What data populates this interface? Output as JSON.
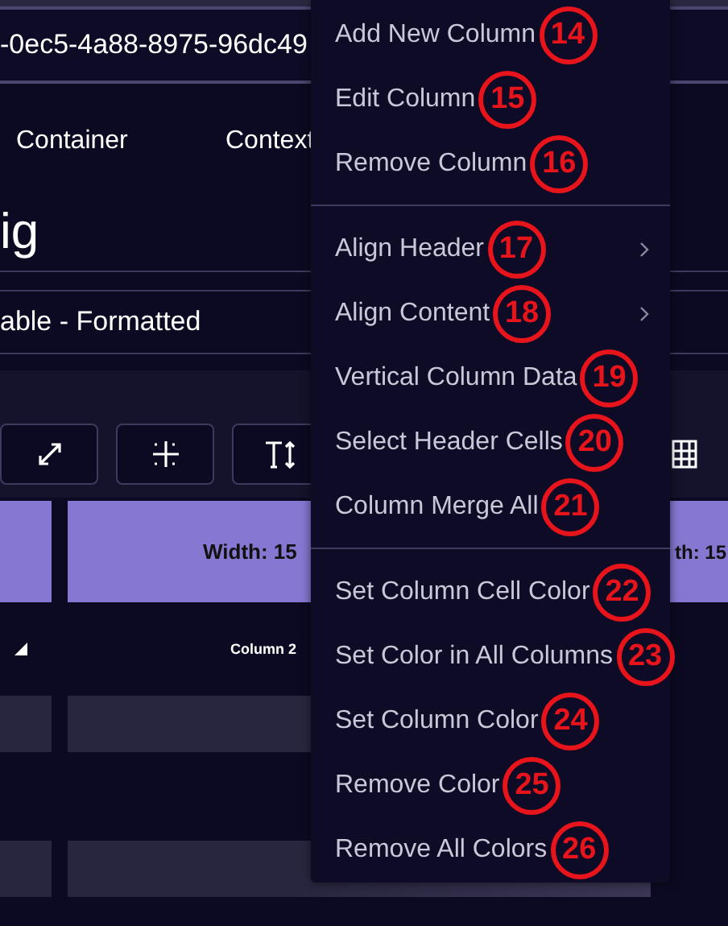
{
  "id_field": {
    "value": "-0ec5-4a88-8975-96dc49"
  },
  "tabs": [
    {
      "label": "Container"
    },
    {
      "label": "Context"
    }
  ],
  "title": "ig",
  "subtitle": "able - Formatted",
  "table": {
    "width_labels": [
      "Width: 15",
      "th: 15"
    ],
    "header": "Column 2"
  },
  "context_menu": {
    "sections": [
      {
        "items": [
          {
            "label": "Add New Column",
            "submenu": false,
            "badge": "14"
          },
          {
            "label": "Edit Column",
            "submenu": false,
            "badge": "15"
          },
          {
            "label": "Remove Column",
            "submenu": false,
            "badge": "16"
          }
        ]
      },
      {
        "items": [
          {
            "label": "Align Header",
            "submenu": true,
            "badge": "17"
          },
          {
            "label": "Align Content",
            "submenu": true,
            "badge": "18"
          },
          {
            "label": "Vertical Column Data",
            "submenu": false,
            "badge": "19"
          },
          {
            "label": "Select Header Cells",
            "submenu": false,
            "badge": "20"
          },
          {
            "label": "Column Merge All",
            "submenu": false,
            "badge": "21"
          }
        ]
      },
      {
        "items": [
          {
            "label": "Set Column Cell Color",
            "submenu": false,
            "badge": "22"
          },
          {
            "label": "Set Color in All Columns",
            "submenu": false,
            "badge": "23"
          },
          {
            "label": "Set Column Color",
            "submenu": false,
            "badge": "24"
          },
          {
            "label": "Remove Color",
            "submenu": false,
            "badge": "25"
          },
          {
            "label": "Remove All Colors",
            "submenu": false,
            "badge": "26"
          }
        ]
      }
    ]
  }
}
